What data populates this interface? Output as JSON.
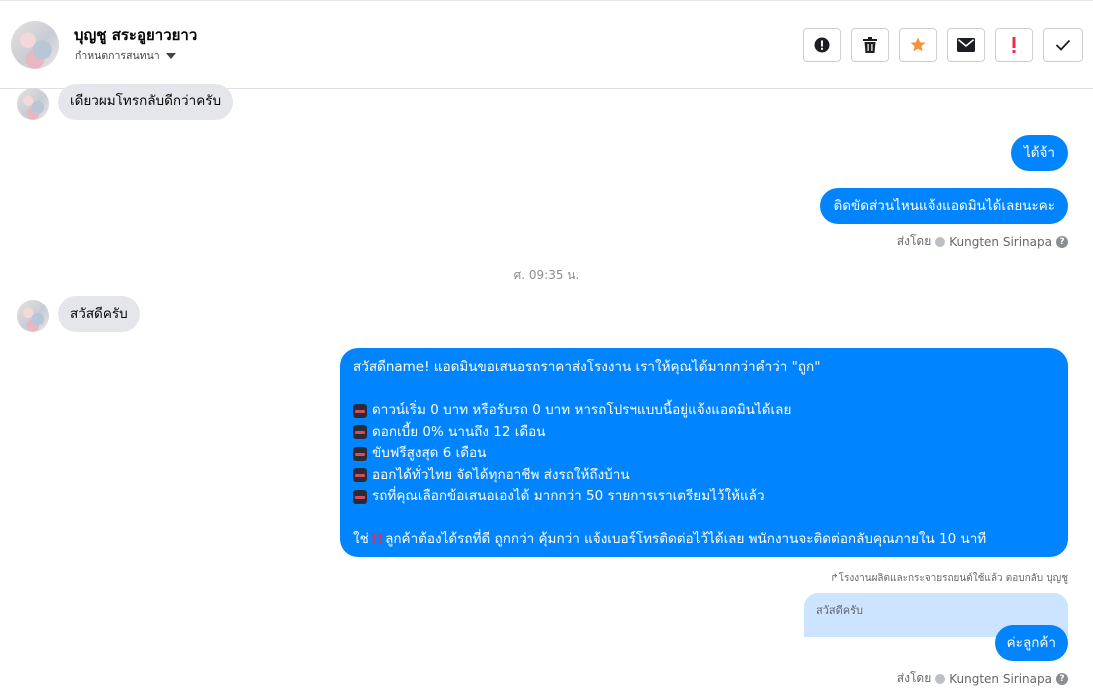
{
  "header": {
    "name": "บุญชู สระอูยาวยาว",
    "subtitle": "กำหนดการสนทนา",
    "toolbar": [
      {
        "icon": "alert-circle-icon",
        "color": "#1c1e21"
      },
      {
        "icon": "trash-icon",
        "color": "#1c1e21"
      },
      {
        "icon": "star-icon",
        "color": "#f7923b"
      },
      {
        "icon": "envelope-icon",
        "color": "#1c1e21"
      },
      {
        "icon": "exclamation-icon",
        "color": "#f02849"
      },
      {
        "icon": "check-icon",
        "color": "#1c1e21"
      }
    ]
  },
  "messages": {
    "m1": "เดียวผมโทรกลับดีกว่าครับ",
    "m2": "ได้จ้า",
    "m3": "ติดขัดส่วนไหนแจ้งแอดมินได้เลยนะคะ",
    "sent_by_label": "ส่งโดย",
    "sent_by_name": "Kungten Sirinapa",
    "timestamp": "ศ. 09:35 น.",
    "m4": "สวัสดีครับ",
    "promo": {
      "line1": "สวัสดีname! แอดมินขอเสนอรถราคาส่งโรงงาน เราให้คุณได้มากกว่าคำว่า \"ถูก\"",
      "items": [
        "ดาวน์เริ่ม 0 บาท หรือรับรถ 0 บาท หารถโปรฯแบบนี้อยู่แจ้งแอดมินได้เลย",
        "ดอกเบี้ย 0% นานถึง 12 เดือน",
        "ขับฟรีสูงสุด 6 เดือน",
        "ออกได้ทั่วไทย จัดได้ทุกอาชีพ ส่งรถให้ถึงบ้าน",
        "รถที่คุณเลือกข้อเสนอเองได้ มากกว่า 50 รายการเราเตรียมไว้ให้แล้ว"
      ],
      "last_prefix": "ใช่",
      "last_rest": "ลูกค้าต้องได้รถที่ดี ถูกกว่า คุ้มกว่า แจ้งเบอร์โทรติดต่อไว้ได้เลย พนักงานจะติดต่อกลับคุณภายใน 10 นาที"
    },
    "reply_meta": "โรงงานผลิตและกระจายรถยนต์ใช้แล้ว ตอบกลับ บุญชู",
    "reply_quote": "สวัสดีครับ",
    "m5": "ค่ะลูกค้า"
  }
}
